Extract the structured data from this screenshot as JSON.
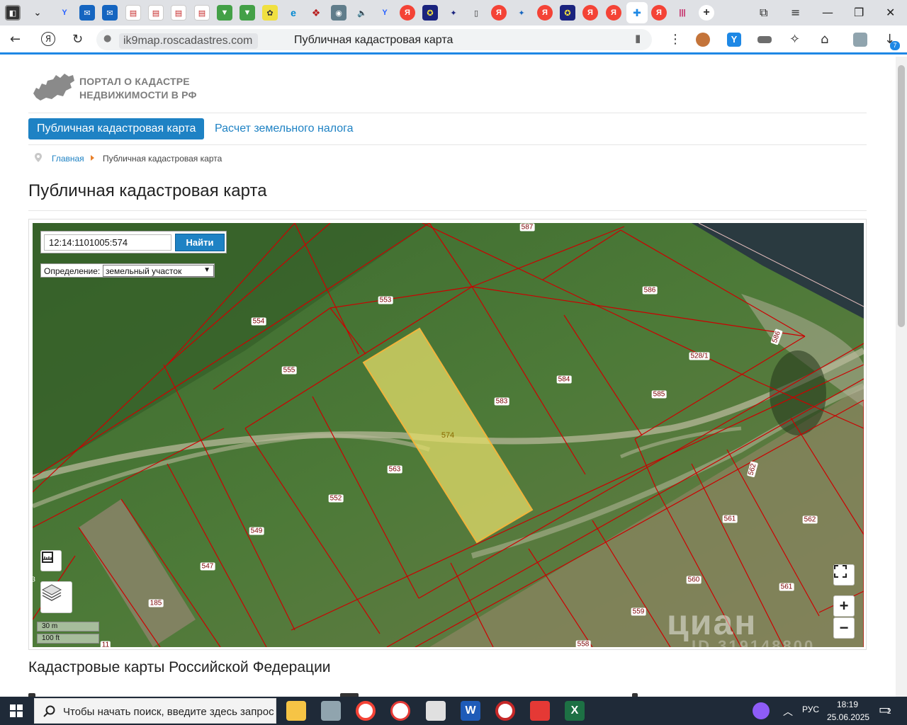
{
  "browser": {
    "url_domain": "ik9map.roscadastres.com",
    "page_title": "Публичная кадастровая карта",
    "downloads_badge": "7"
  },
  "site": {
    "logo_line1": "ПОРТАЛ О КАДАСТРЕ",
    "logo_line2": "НЕДВИЖИМОСТИ В РФ",
    "nav_active": "Публичная кадастровая карта",
    "nav_link": "Расчет земельного налога",
    "breadcrumb_home": "Главная",
    "breadcrumb_current": "Публичная кадастровая карта",
    "heading": "Публичная кадастровая карта",
    "section_heading": "Кадастровые карты Российской Федерации"
  },
  "map": {
    "search_value": "12:14:1101005:574",
    "search_button": "Найти",
    "definition_label": "Определение:",
    "definition_value": "земельный участок",
    "selected_parcel": "574",
    "parcel_labels": [
      "587",
      "553",
      "554",
      "586",
      "586",
      "528/1",
      "555",
      "584",
      "583",
      "585",
      "563",
      "552",
      "549",
      "547",
      "185",
      "11",
      "562",
      "561",
      "562",
      "561",
      "560",
      "561",
      "559",
      "558",
      "3"
    ],
    "scale_m": "30 m",
    "scale_ft": "100 ft",
    "zoom_in": "+",
    "zoom_out": "−",
    "watermark": "циан",
    "watermark_id": "ID 319148800"
  },
  "taskbar": {
    "search_placeholder": "Чтобы начать поиск, введите здесь запрос",
    "lang": "РУС",
    "time": "18:19",
    "date": "25.06.2025",
    "notifications": "2"
  }
}
